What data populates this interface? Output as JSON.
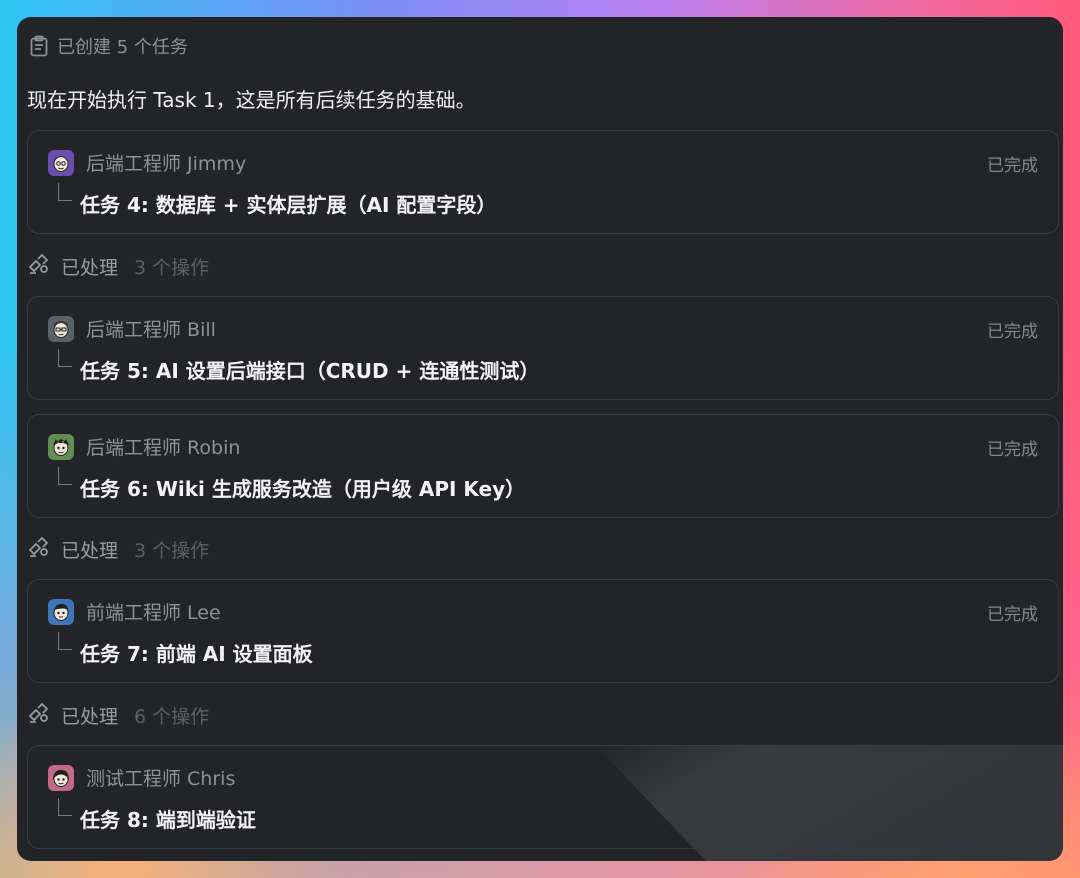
{
  "header": {
    "label": "已创建 5 个任务"
  },
  "intro": "现在开始执行 Task 1，这是所有后续任务的基础。",
  "cards": [
    {
      "agent": "后端工程师 Jimmy",
      "status": "已完成",
      "task": "任务 4: 数据库 + 实体层扩展（AI 配置字段）",
      "avatar_color": "#6a4fb0"
    },
    {
      "agent": "后端工程师 Bill",
      "status": "已完成",
      "task": "任务 5: AI 设置后端接口（CRUD + 连通性测试）",
      "avatar_color": "#5c6068"
    },
    {
      "agent": "后端工程师 Robin",
      "status": "已完成",
      "task": "任务 6: Wiki 生成服务改造（用户级 API Key）",
      "avatar_color": "#5f8f52"
    },
    {
      "agent": "前端工程师 Lee",
      "status": "已完成",
      "task": "任务 7: 前端 AI 设置面板",
      "avatar_color": "#3f74b8"
    },
    {
      "agent": "测试工程师 Chris",
      "status": "",
      "task": "任务 8: 端到端验证",
      "avatar_color": "#c06a8a"
    }
  ],
  "processed": [
    {
      "label": "已处理",
      "count": "3 个操作"
    },
    {
      "label": "已处理",
      "count": "3 个操作"
    },
    {
      "label": "已处理",
      "count": "6 个操作"
    }
  ],
  "icons": {
    "header": "clipboard-icon",
    "processed": "tools-icon",
    "branch": "branch-connector-icon"
  }
}
